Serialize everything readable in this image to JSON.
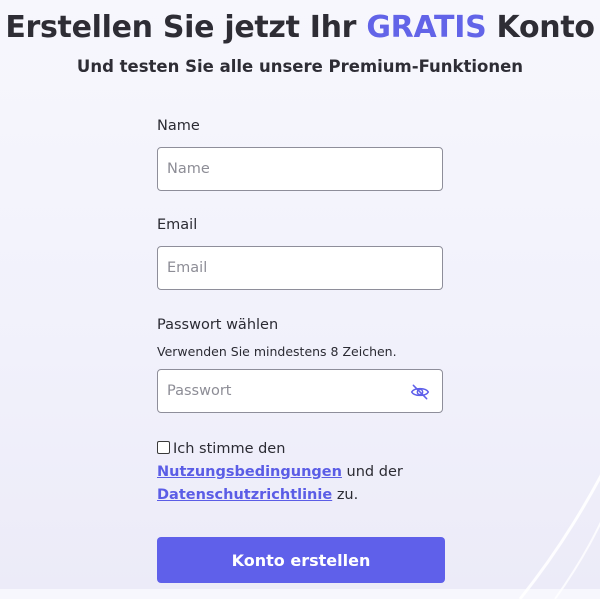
{
  "header": {
    "title_prefix": "Erstellen Sie jetzt Ihr",
    "title_accent": "GRATIS",
    "title_suffix": "Konto",
    "subtitle": "Und testen Sie alle unsere Premium-Funktionen"
  },
  "form": {
    "name": {
      "label": "Name",
      "placeholder": "Name",
      "value": ""
    },
    "email": {
      "label": "Email",
      "placeholder": "Email",
      "value": ""
    },
    "password": {
      "label": "Passwort wählen",
      "hint": "Verwenden Sie mindestens 8 Zeichen.",
      "placeholder": "Passwort",
      "value": "",
      "toggle_icon": "eye-slash-icon"
    },
    "consent": {
      "checked": false,
      "text_before": "Ich stimme den",
      "terms_link": "Nutzungsbedingungen",
      "text_middle": "und der",
      "privacy_link": "Datenschutzrichtlinie",
      "text_after": "zu."
    },
    "submit_label": "Konto erstellen"
  },
  "colors": {
    "accent": "#6264e8",
    "button": "#5f60ea",
    "text": "#2e2d35"
  }
}
